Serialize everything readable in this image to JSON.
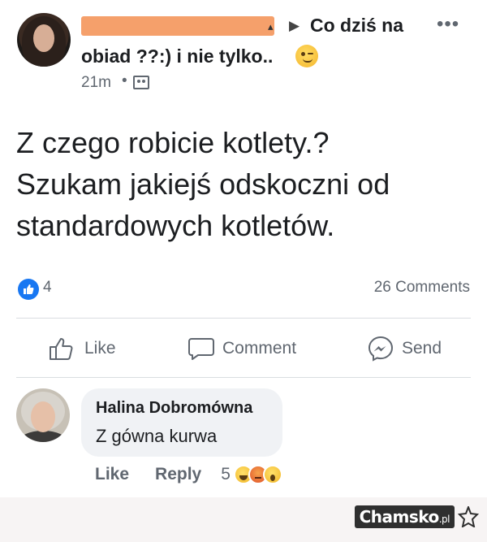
{
  "post": {
    "name_tail": "▴",
    "arrow": "▶",
    "group_name_line1": "Co dziś na",
    "group_name_line2": "obiad ??:) i nie tylko..",
    "more": "•••",
    "timestamp": "21m",
    "separator": "•",
    "body_lines": [
      "Z czego robicie kotlety.?",
      "Szukam jakiejś odskoczni od",
      "standardowych kotletów."
    ]
  },
  "stats": {
    "reactions": "4",
    "comments": "26 Comments"
  },
  "actions": {
    "like": "Like",
    "comment": "Comment",
    "send": "Send"
  },
  "comment": {
    "author": "Halina Dobromówna",
    "text": "Z gówna kurwa",
    "like_label": "Like",
    "reply_label": "Reply",
    "reaction_count": "5"
  },
  "watermark": {
    "brand": "Chamsko",
    "suffix": ".pl"
  },
  "colors": {
    "accent": "#1877f2",
    "redaction": "#f5a06b",
    "muted_text": "#606770"
  }
}
